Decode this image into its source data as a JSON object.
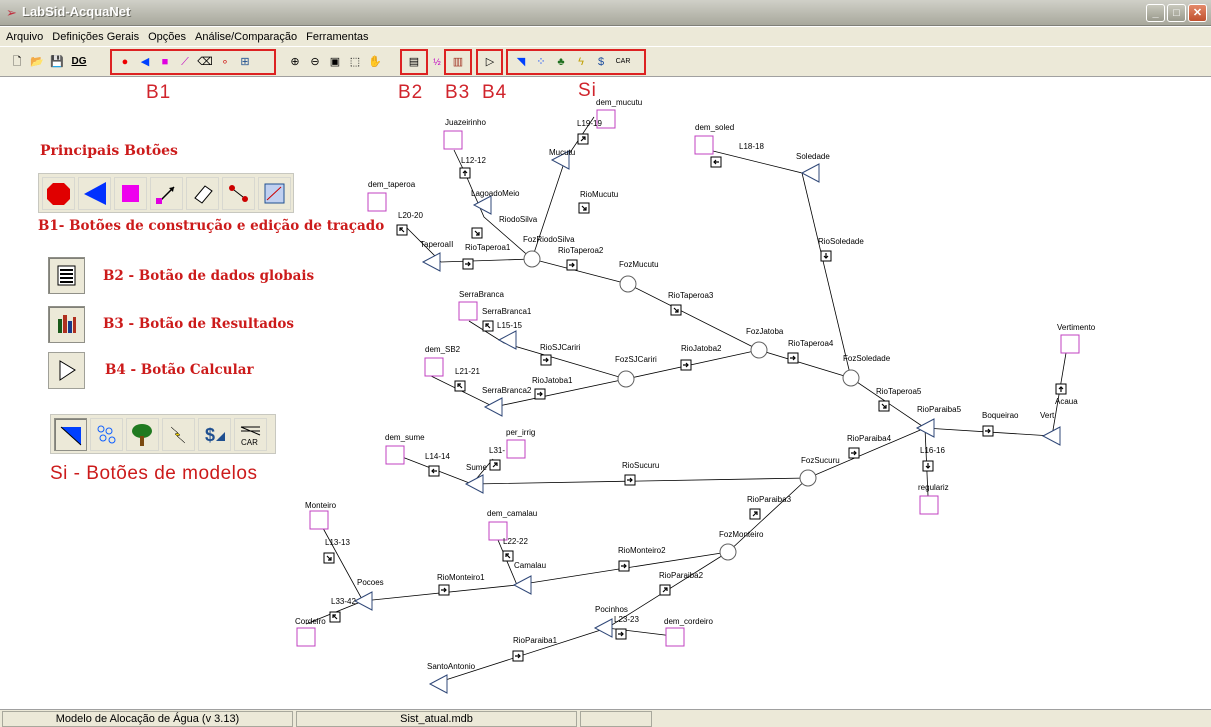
{
  "window": {
    "title": "LabSid-AcquaNet"
  },
  "menu": [
    "Arquivo",
    "Definições Gerais",
    "Opções",
    "Análise/Comparação",
    "Ferramentas"
  ],
  "toolbar": {
    "dg_label": "DG"
  },
  "callouts": {
    "b1": "B1",
    "b2": "B2",
    "b3": "B3",
    "b4": "B4",
    "si": "Si"
  },
  "legend": {
    "heading": "Principais Botões",
    "b1": "B1- Botões de construção e edição de traçado",
    "b2": "B2 - Botão de dados globais",
    "b3": "B3 - Botão de Resultados",
    "b4": "B4 - Botão Calcular",
    "si": "Si - Botões de modelos",
    "car_label": "CAR"
  },
  "network_labels": [
    "dem_mucutu",
    "L19-19",
    "Mucutu",
    "Juazeirinho",
    "L12-12",
    "LagoadoMeio",
    "RiodoSilva",
    "FozRiodoSilva",
    "RioMucutu",
    "FozMucutu",
    "dem_soled",
    "L18-18",
    "Soledade",
    "RioSoledade",
    "dem_taperoa",
    "L20-20",
    "TaperoaII",
    "RioTaperoa1",
    "RioTaperoa2",
    "RioTaperoa3",
    "FozJatoba",
    "RioTaperoa4",
    "FozSoledade",
    "SerraBranca",
    "L15-15",
    "SerraBranca1",
    "RioSJCariri",
    "FozSJCariri",
    "RioJatoba2",
    "RioJatoba1",
    "dem_SB2",
    "L21-21",
    "SerraBranca2",
    "RioTaperoa5",
    "Boqueirao",
    "RioParaiba5",
    "Acaua",
    "Vert",
    "Vertimento",
    "per_irrig",
    "L31-",
    "dem_sume",
    "L14-14",
    "Sume",
    "RioSucuru",
    "FozSucuru",
    "RioParaiba4",
    "L16-16",
    "regulariz",
    "RioParaiba3",
    "Monteiro",
    "L13-13",
    "dem_camalau",
    "L22-22",
    "Camalau",
    "RioMonteiro2",
    "FozMonteiro",
    "Pocoes",
    "RioMonteiro1",
    "RioParaiba2",
    "L33-42",
    "Pocinhos",
    "Cordeiro",
    "L23-23",
    "dem_cordeiro",
    "RioParaiba1",
    "SantoAntonio"
  ],
  "status": {
    "model": "Modelo de Alocação de Água (v 3.13)",
    "file": "Sist_atual.mdb"
  }
}
